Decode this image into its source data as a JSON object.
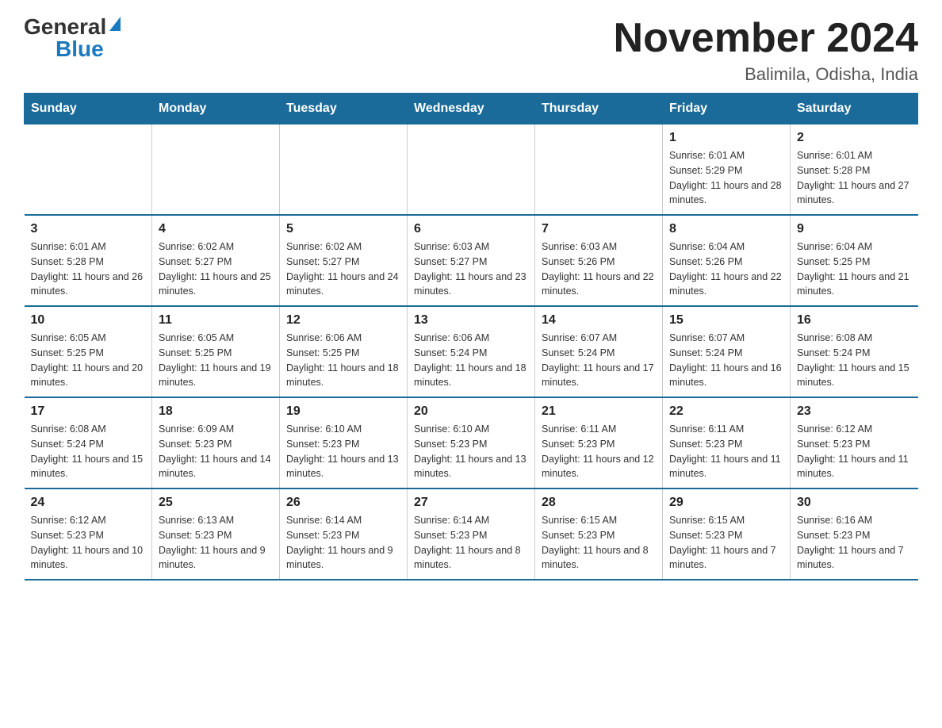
{
  "header": {
    "logo_general": "General",
    "logo_blue": "Blue",
    "month_title": "November 2024",
    "location": "Balimila, Odisha, India"
  },
  "calendar": {
    "days_of_week": [
      "Sunday",
      "Monday",
      "Tuesday",
      "Wednesday",
      "Thursday",
      "Friday",
      "Saturday"
    ],
    "weeks": [
      [
        {
          "day": "",
          "info": ""
        },
        {
          "day": "",
          "info": ""
        },
        {
          "day": "",
          "info": ""
        },
        {
          "day": "",
          "info": ""
        },
        {
          "day": "",
          "info": ""
        },
        {
          "day": "1",
          "info": "Sunrise: 6:01 AM\nSunset: 5:29 PM\nDaylight: 11 hours and 28 minutes."
        },
        {
          "day": "2",
          "info": "Sunrise: 6:01 AM\nSunset: 5:28 PM\nDaylight: 11 hours and 27 minutes."
        }
      ],
      [
        {
          "day": "3",
          "info": "Sunrise: 6:01 AM\nSunset: 5:28 PM\nDaylight: 11 hours and 26 minutes."
        },
        {
          "day": "4",
          "info": "Sunrise: 6:02 AM\nSunset: 5:27 PM\nDaylight: 11 hours and 25 minutes."
        },
        {
          "day": "5",
          "info": "Sunrise: 6:02 AM\nSunset: 5:27 PM\nDaylight: 11 hours and 24 minutes."
        },
        {
          "day": "6",
          "info": "Sunrise: 6:03 AM\nSunset: 5:27 PM\nDaylight: 11 hours and 23 minutes."
        },
        {
          "day": "7",
          "info": "Sunrise: 6:03 AM\nSunset: 5:26 PM\nDaylight: 11 hours and 22 minutes."
        },
        {
          "day": "8",
          "info": "Sunrise: 6:04 AM\nSunset: 5:26 PM\nDaylight: 11 hours and 22 minutes."
        },
        {
          "day": "9",
          "info": "Sunrise: 6:04 AM\nSunset: 5:25 PM\nDaylight: 11 hours and 21 minutes."
        }
      ],
      [
        {
          "day": "10",
          "info": "Sunrise: 6:05 AM\nSunset: 5:25 PM\nDaylight: 11 hours and 20 minutes."
        },
        {
          "day": "11",
          "info": "Sunrise: 6:05 AM\nSunset: 5:25 PM\nDaylight: 11 hours and 19 minutes."
        },
        {
          "day": "12",
          "info": "Sunrise: 6:06 AM\nSunset: 5:25 PM\nDaylight: 11 hours and 18 minutes."
        },
        {
          "day": "13",
          "info": "Sunrise: 6:06 AM\nSunset: 5:24 PM\nDaylight: 11 hours and 18 minutes."
        },
        {
          "day": "14",
          "info": "Sunrise: 6:07 AM\nSunset: 5:24 PM\nDaylight: 11 hours and 17 minutes."
        },
        {
          "day": "15",
          "info": "Sunrise: 6:07 AM\nSunset: 5:24 PM\nDaylight: 11 hours and 16 minutes."
        },
        {
          "day": "16",
          "info": "Sunrise: 6:08 AM\nSunset: 5:24 PM\nDaylight: 11 hours and 15 minutes."
        }
      ],
      [
        {
          "day": "17",
          "info": "Sunrise: 6:08 AM\nSunset: 5:24 PM\nDaylight: 11 hours and 15 minutes."
        },
        {
          "day": "18",
          "info": "Sunrise: 6:09 AM\nSunset: 5:23 PM\nDaylight: 11 hours and 14 minutes."
        },
        {
          "day": "19",
          "info": "Sunrise: 6:10 AM\nSunset: 5:23 PM\nDaylight: 11 hours and 13 minutes."
        },
        {
          "day": "20",
          "info": "Sunrise: 6:10 AM\nSunset: 5:23 PM\nDaylight: 11 hours and 13 minutes."
        },
        {
          "day": "21",
          "info": "Sunrise: 6:11 AM\nSunset: 5:23 PM\nDaylight: 11 hours and 12 minutes."
        },
        {
          "day": "22",
          "info": "Sunrise: 6:11 AM\nSunset: 5:23 PM\nDaylight: 11 hours and 11 minutes."
        },
        {
          "day": "23",
          "info": "Sunrise: 6:12 AM\nSunset: 5:23 PM\nDaylight: 11 hours and 11 minutes."
        }
      ],
      [
        {
          "day": "24",
          "info": "Sunrise: 6:12 AM\nSunset: 5:23 PM\nDaylight: 11 hours and 10 minutes."
        },
        {
          "day": "25",
          "info": "Sunrise: 6:13 AM\nSunset: 5:23 PM\nDaylight: 11 hours and 9 minutes."
        },
        {
          "day": "26",
          "info": "Sunrise: 6:14 AM\nSunset: 5:23 PM\nDaylight: 11 hours and 9 minutes."
        },
        {
          "day": "27",
          "info": "Sunrise: 6:14 AM\nSunset: 5:23 PM\nDaylight: 11 hours and 8 minutes."
        },
        {
          "day": "28",
          "info": "Sunrise: 6:15 AM\nSunset: 5:23 PM\nDaylight: 11 hours and 8 minutes."
        },
        {
          "day": "29",
          "info": "Sunrise: 6:15 AM\nSunset: 5:23 PM\nDaylight: 11 hours and 7 minutes."
        },
        {
          "day": "30",
          "info": "Sunrise: 6:16 AM\nSunset: 5:23 PM\nDaylight: 11 hours and 7 minutes."
        }
      ]
    ]
  }
}
